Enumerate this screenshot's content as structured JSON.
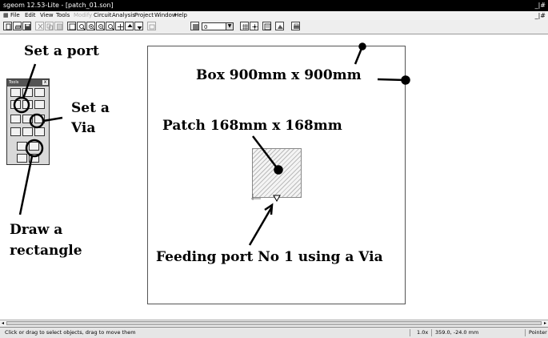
{
  "window": {
    "title": "sgeom 12.53-Lite - [patch_01.son]",
    "controls": "_|#",
    "doc_controls": "_|#"
  },
  "menu": {
    "items": [
      {
        "label": "File",
        "enabled": true
      },
      {
        "label": "Edit",
        "enabled": true
      },
      {
        "label": "View",
        "enabled": true
      },
      {
        "label": "Tools",
        "enabled": true
      },
      {
        "label": "Modify",
        "enabled": false
      },
      {
        "label": "Circuit",
        "enabled": true
      },
      {
        "label": "Analysis",
        "enabled": true
      },
      {
        "label": "Project",
        "enabled": true
      },
      {
        "label": "Window",
        "enabled": true
      },
      {
        "label": "Help",
        "enabled": true
      }
    ]
  },
  "toolbar": {
    "level_value": "0",
    "icons": [
      "new-file-icon",
      "open-file-icon",
      "save-icon",
      "cut-icon",
      "copy-icon",
      "paste-icon",
      "zoom-fit-icon",
      "zoom-area-icon",
      "zoom-in-icon",
      "zoom-out-icon",
      "zoom-previous-icon",
      "pan-icon",
      "level-up-icon",
      "level-down-icon",
      "view-3d-icon",
      "level-select-icon",
      "grid-icon",
      "snap-icon",
      "properties-icon",
      "current-density-icon",
      "print-icon"
    ]
  },
  "palette": {
    "title": "Tools",
    "close": "x"
  },
  "annotations": {
    "set_port": "Set a port",
    "set_via_line1": "Set a",
    "set_via_line2": "Via",
    "draw_rect_line1": "Draw a",
    "draw_rect_line2": "rectangle",
    "box": "Box 900mm x 900mm",
    "patch": "Patch 168mm x 168mm",
    "feeding": "Feeding port No 1 using a Via"
  },
  "status": {
    "hint": "Click or drag to select objects, drag to move them",
    "zoom": "1.0x",
    "coords": "359.0, -24.0 mm",
    "mode": "Pointer"
  },
  "scrollbar": {
    "left_arrow": "◂",
    "right_arrow": "▸"
  }
}
